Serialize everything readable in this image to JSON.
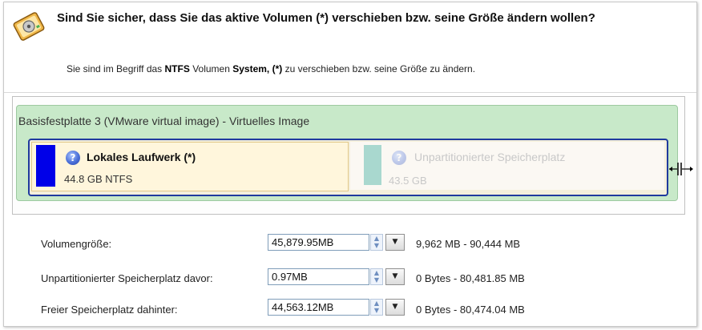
{
  "header": {
    "title": "Sind Sie sicher, dass Sie das aktive Volumen (*) verschieben bzw. seine Größe ändern wollen?",
    "sub_prefix": "Sie sind im Begriff das ",
    "sub_fs": "NTFS",
    "sub_mid": " Volumen ",
    "sub_volume": "System, (*)",
    "sub_suffix": " zu verschieben bzw. seine Größe zu ändern."
  },
  "disk": {
    "title": "Basisfestplatte 3 (VMware virtual image) - Virtuelles Image",
    "partitions": [
      {
        "label": "Lokales Laufwerk (*)",
        "size": "44.8 GB NTFS",
        "color": "#0000e8"
      },
      {
        "label": "Unpartitionierter Speicherplatz",
        "size": "43.5 GB",
        "color": "#a9d8cf"
      }
    ]
  },
  "fields": [
    {
      "label": "Volumengröße:",
      "value": "45,879.95MB",
      "range": "9,962 MB - 90,444 MB"
    },
    {
      "label": "Unpartitionierter Speicherplatz davor:",
      "value": "0.97MB",
      "range": "0 Bytes - 80,481.85 MB"
    },
    {
      "label": "Freier Speicherplatz dahinter:",
      "value": "44,563.12MB",
      "range": "0 Bytes - 80,474.04 MB"
    }
  ],
  "icons": {
    "app": "hard-disk-warning-icon",
    "partition": "question-icon",
    "resize": "resize-handle-icon",
    "spinner": "spin-arrows-icon",
    "dropdown": "dropdown-arrow-icon"
  },
  "colors": {
    "disk_panel": "#c8e9c9",
    "map_border": "#1f3a9e",
    "field_border": "#7f9db9"
  }
}
